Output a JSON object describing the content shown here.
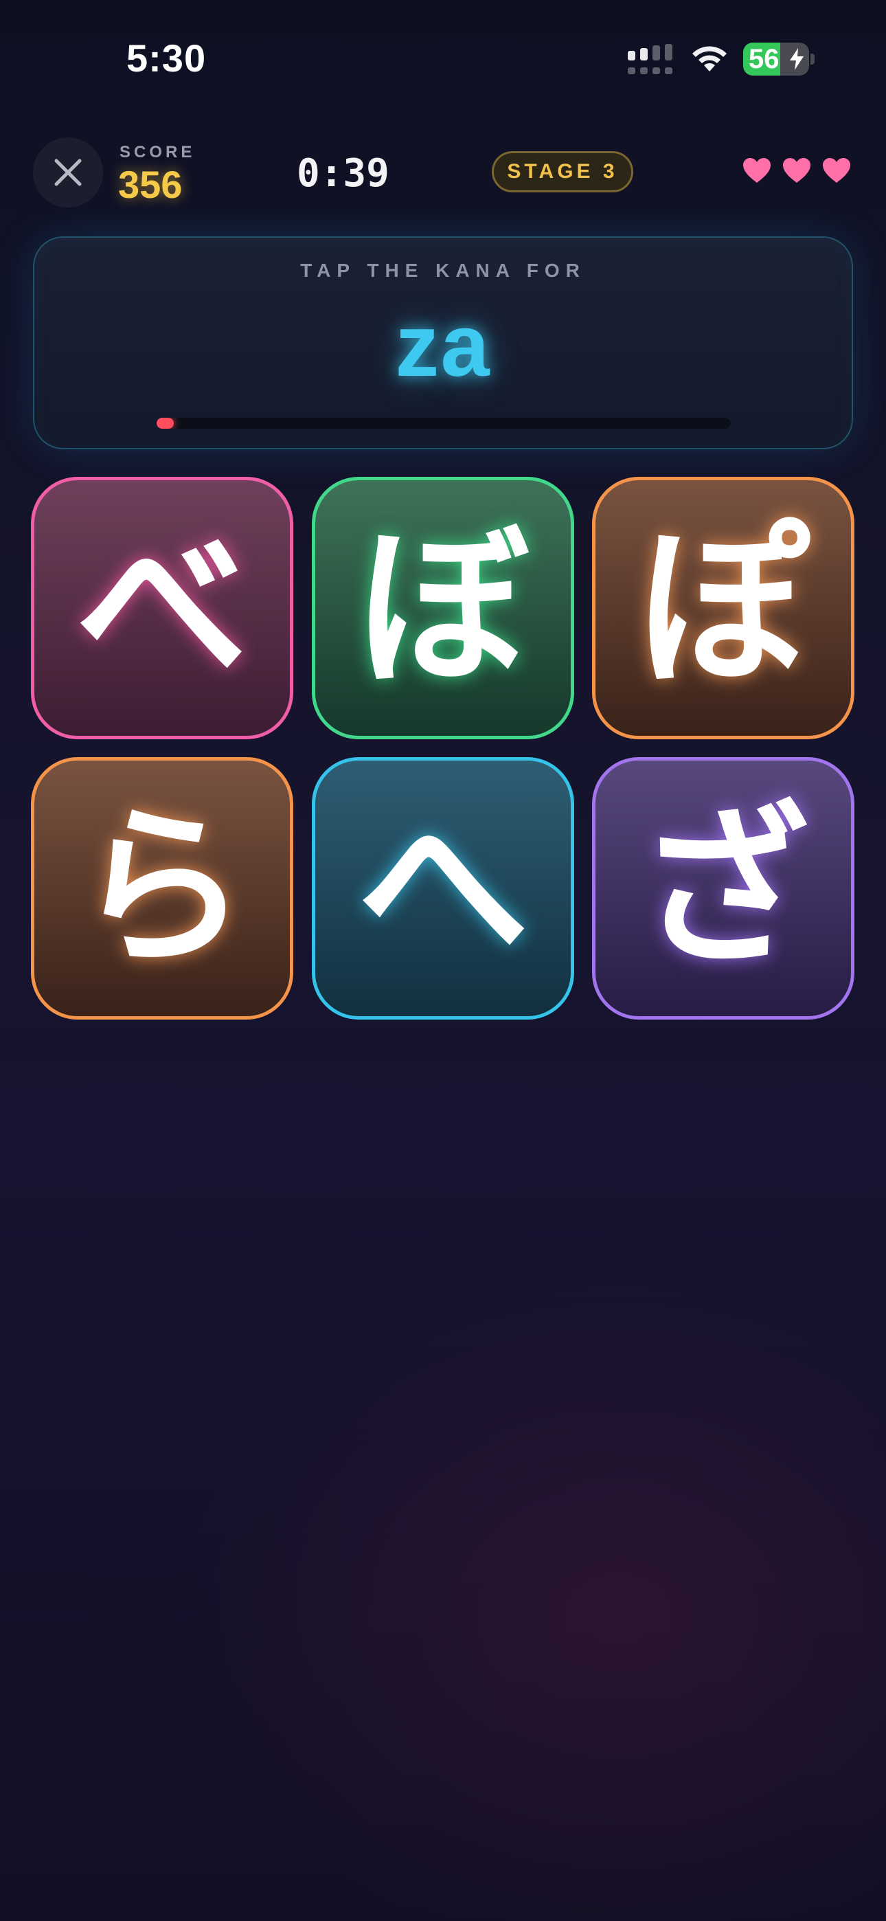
{
  "status_bar": {
    "time": "5:30",
    "battery_level": "56",
    "battery_fraction": 0.56,
    "icons": [
      "signal-icon",
      "wifi-icon",
      "battery-charging-icon"
    ]
  },
  "header": {
    "close_icon": "close-icon",
    "score_label": "SCORE",
    "score_value": "356",
    "timer": "0:39",
    "stage": "STAGE 3",
    "lives": 3,
    "life_icon": "heart-icon"
  },
  "prompt": {
    "label": "TAP THE KANA FOR",
    "romaji": "za",
    "time_remaining_fraction": 0.03
  },
  "tiles": [
    {
      "kana": "べ",
      "color": "#ef5ea6"
    },
    {
      "kana": "ぼ",
      "color": "#41d88c"
    },
    {
      "kana": "ぽ",
      "color": "#f4934a"
    },
    {
      "kana": "ら",
      "color": "#f4934a"
    },
    {
      "kana": "へ",
      "color": "#35c3ea"
    },
    {
      "kana": "ざ",
      "color": "#a274ee"
    }
  ],
  "colors": {
    "score": "#f7c948",
    "accent": "#3ec9f0",
    "stage": "#f2c14e",
    "hearts": "#ff6fa8",
    "timer_bar": "#ff4d5e"
  }
}
